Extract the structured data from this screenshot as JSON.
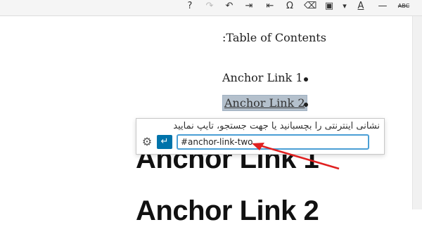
{
  "toolbar": {
    "icons": [
      "help-icon",
      "redo-icon",
      "undo-icon",
      "indent-icon",
      "outdent-icon",
      "special-character-icon",
      "eraser-icon",
      "paste-text-icon",
      "more-icon",
      "text-color-icon",
      "horizontal-line-icon",
      "strikethrough-icon"
    ],
    "help_glyph": "?",
    "redo_glyph": "↷",
    "undo_glyph": "↶",
    "indent_glyph": "⇥",
    "outdent_glyph": "⇤",
    "omega_glyph": "Ω",
    "eraser_glyph": "⌫",
    "paste_glyph": "▣",
    "caret_glyph": "▾",
    "textcolor_glyph": "A",
    "hr_glyph": "—",
    "strike_glyph": "ABC"
  },
  "content": {
    "toc_title": ":Table of Contents",
    "items": [
      "Anchor Link 1",
      "Anchor Link 2"
    ],
    "heading_1": "Anchor Link 1",
    "heading_2": "Anchor Link 2"
  },
  "link_popup": {
    "hint": "نشانی اینترنتی را بچسبانید یا جهت جستجو، تایپ نمایید",
    "url_value": "#anchor-link-two",
    "apply_glyph": "↵",
    "settings_glyph": "⚙"
  },
  "colors": {
    "accent": "#0073aa",
    "highlight": "#b4c0cc",
    "annotation_arrow": "#e02020"
  }
}
